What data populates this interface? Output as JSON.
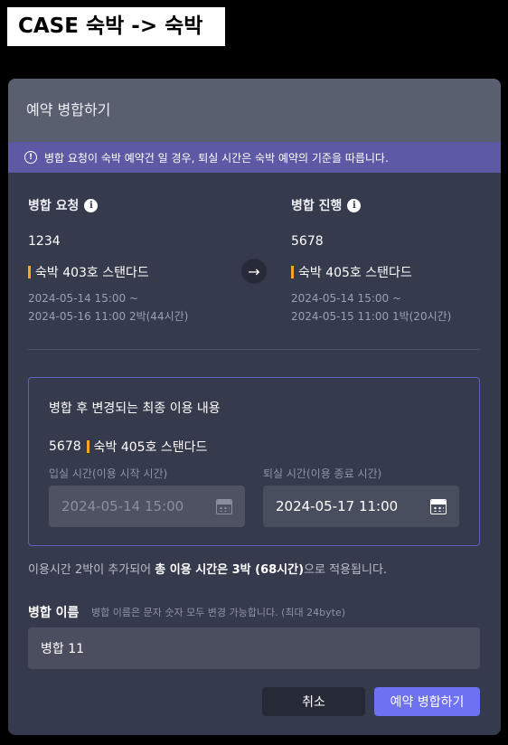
{
  "case_label": "CASE 숙박 -> 숙박",
  "modal": {
    "title": "예약 병합하기",
    "notice": "병합 요청이 숙박 예약건 일 경우, 퇴실 시간은 숙박 예약의 기준을 따릅니다."
  },
  "request": {
    "title": "병합 요청",
    "number": "1234",
    "room": "숙박  403호  스탠다드",
    "date_line1": "2024-05-14 15:00 ~",
    "date_line2": "2024-05-16 11:00 2박(44시간)"
  },
  "progress": {
    "title": "병합 진행",
    "number": "5678",
    "room": "숙박  405호  스탠다드",
    "date_line1": "2024-05-14 15:00 ~",
    "date_line2": "2024-05-15 11:00 1박(20시간)"
  },
  "final": {
    "title": "병합 후 변경되는 최종 이용 내용",
    "number": "5678",
    "room": "숙박  405호  스탠다드",
    "checkin_label": "입실 시간(이용 시작 시간)",
    "checkin_value": "2024-05-14 15:00",
    "checkout_label": "퇴실 시간(이용 종료 시간)",
    "checkout_value": "2024-05-17 11:00"
  },
  "summary": {
    "prefix": "이용시간 2박이 추가되어 ",
    "bold": "총 이용 시간은 3박 (68시간)",
    "suffix": "으로 적용됩니다."
  },
  "merge_name": {
    "label": "병합 이름",
    "hint": "병합 이름은 문자 숫자 모두 변경 가능합니다. (최대 24byte)",
    "value": "병합 11"
  },
  "buttons": {
    "cancel": "취소",
    "merge": "예약 병합하기"
  },
  "colors": {
    "accent": "#6f72f0",
    "room_marker": "#f6a623",
    "notice_bg": "#5d59a4"
  }
}
